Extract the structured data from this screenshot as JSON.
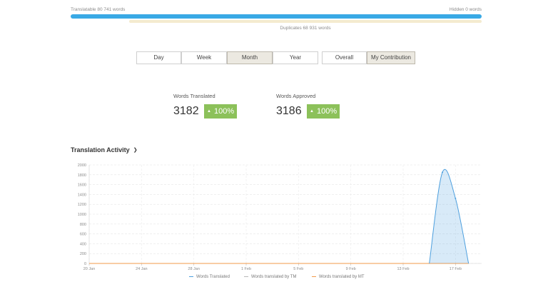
{
  "summary": {
    "translatable": "Translatable 80 741 words",
    "hidden": "Hidden 0 words",
    "duplicates": "Duplicates 68 931 words"
  },
  "period_tabs": [
    "Day",
    "Week",
    "Month",
    "Year"
  ],
  "period_active": "Month",
  "scope_tabs": [
    "Overall",
    "My Contribution"
  ],
  "scope_active": "My Contribution",
  "stats": {
    "translated": {
      "label": "Words Translated",
      "value": "3182",
      "change": "100%"
    },
    "approved": {
      "label": "Words Approved",
      "value": "3186",
      "change": "100%"
    }
  },
  "section": {
    "title": "Translation Activity"
  },
  "colors": {
    "progress": "#39a9e5",
    "duplicates": "#f4ebcf",
    "badge": "#8cc15a",
    "series_translated": "#4d9fde",
    "series_tm": "#b8b8b8",
    "series_mt": "#f2994a"
  },
  "icons": {
    "badge_arrow": "triangle-up-icon",
    "dropdown": "chevron-down-icon"
  },
  "chart_data": {
    "type": "area",
    "ylim": [
      0,
      2000
    ],
    "yticks": [
      0,
      200,
      400,
      600,
      800,
      1000,
      1200,
      1400,
      1600,
      1800,
      2000
    ],
    "xlim": [
      "2024-01-20",
      "2024-02-19"
    ],
    "xticks": [
      "20 Jan",
      "24 Jan",
      "28 Jan",
      "1 Feb",
      "5 Feb",
      "9 Feb",
      "13 Feb",
      "17 Feb"
    ],
    "xtick_dates": [
      "2024-01-20",
      "2024-01-24",
      "2024-01-28",
      "2024-02-01",
      "2024-02-05",
      "2024-02-09",
      "2024-02-13",
      "2024-02-17"
    ],
    "grid": true,
    "legend_position": "bottom",
    "series": [
      {
        "name": "Words Translated",
        "points": [
          [
            "2024-02-15",
            0
          ],
          [
            "2024-02-16",
            1850
          ],
          [
            "2024-02-17",
            1320
          ],
          [
            "2024-02-18",
            0
          ]
        ]
      },
      {
        "name": "Words translated by TM",
        "points": [
          [
            "2024-01-20",
            0
          ],
          [
            "2024-02-18",
            0
          ]
        ]
      },
      {
        "name": "Words translated by MT",
        "points": [
          [
            "2024-01-20",
            0
          ],
          [
            "2024-02-18",
            0
          ]
        ]
      }
    ]
  }
}
